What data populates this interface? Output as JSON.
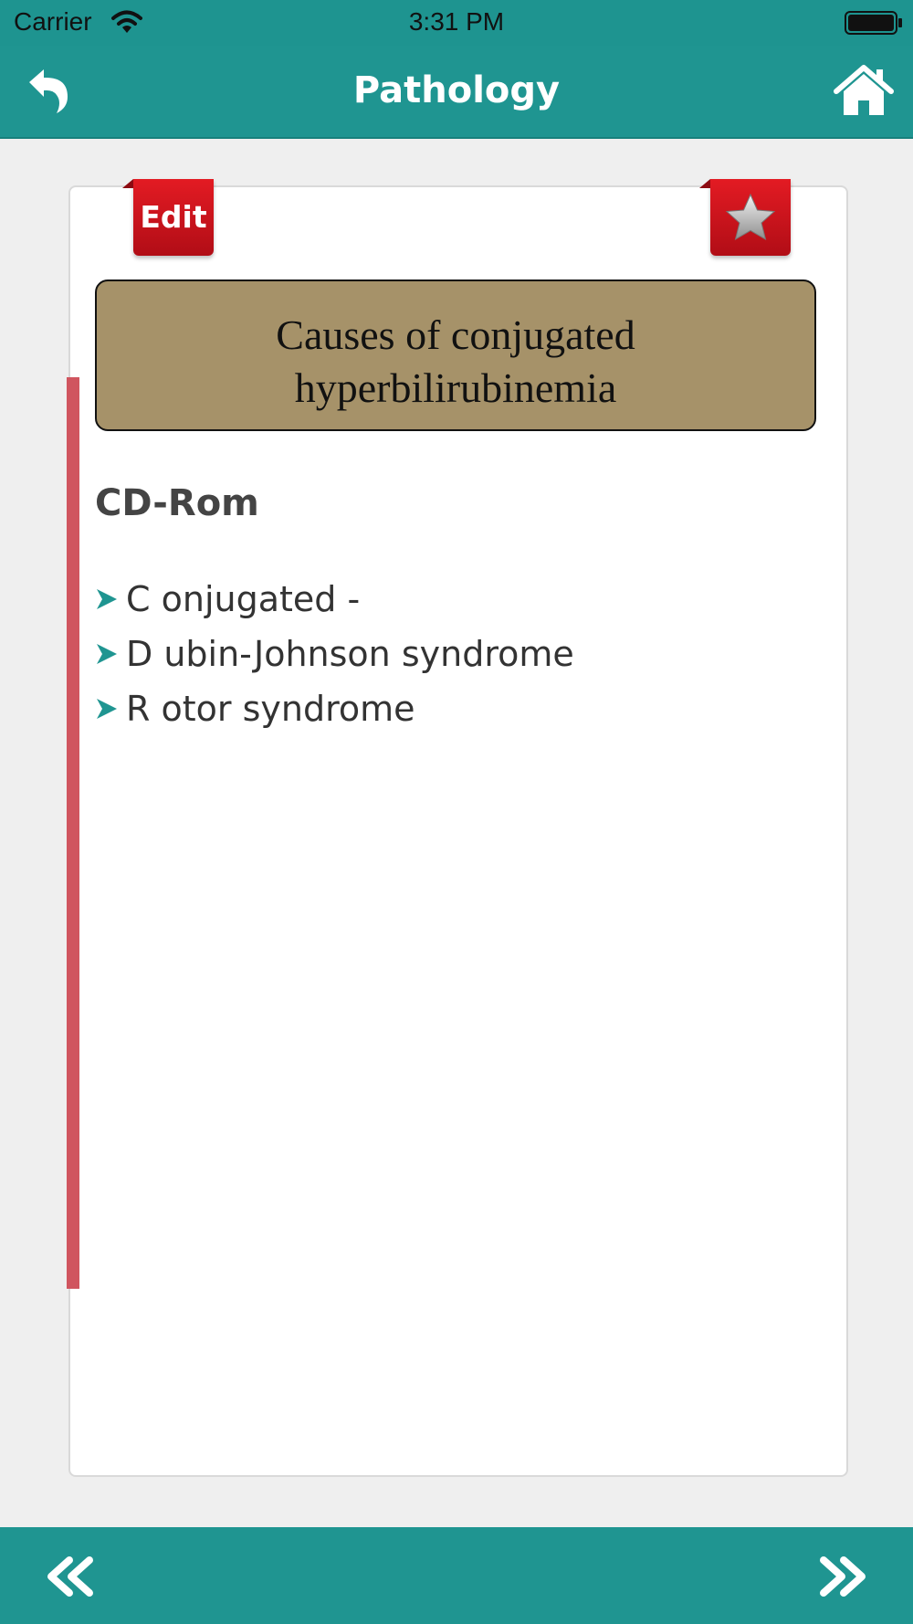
{
  "status_bar": {
    "carrier": "Carrier",
    "time": "3:31 PM",
    "icons": [
      "wifi-icon",
      "battery-icon"
    ]
  },
  "nav": {
    "title": "Pathology",
    "back_icon": "back-arrow-icon",
    "home_icon": "home-icon"
  },
  "card": {
    "edit_label": "Edit",
    "favorite_icon": "star-icon",
    "title_line1": "Causes of conjugated",
    "title_line2": "hyperbilirubinemia",
    "heading": "CD-Rom",
    "items": [
      {
        "text": "C onjugated -"
      },
      {
        "text": "D ubin-Johnson syndrome"
      },
      {
        "text": "R otor syndrome"
      }
    ]
  },
  "bottom": {
    "prev_icon": "double-chevron-left-icon",
    "next_icon": "double-chevron-right-icon"
  },
  "colors": {
    "teal": "#1f9591",
    "red": "#e31b23",
    "title_box": "#a69269",
    "stripe": "#d0555f"
  }
}
